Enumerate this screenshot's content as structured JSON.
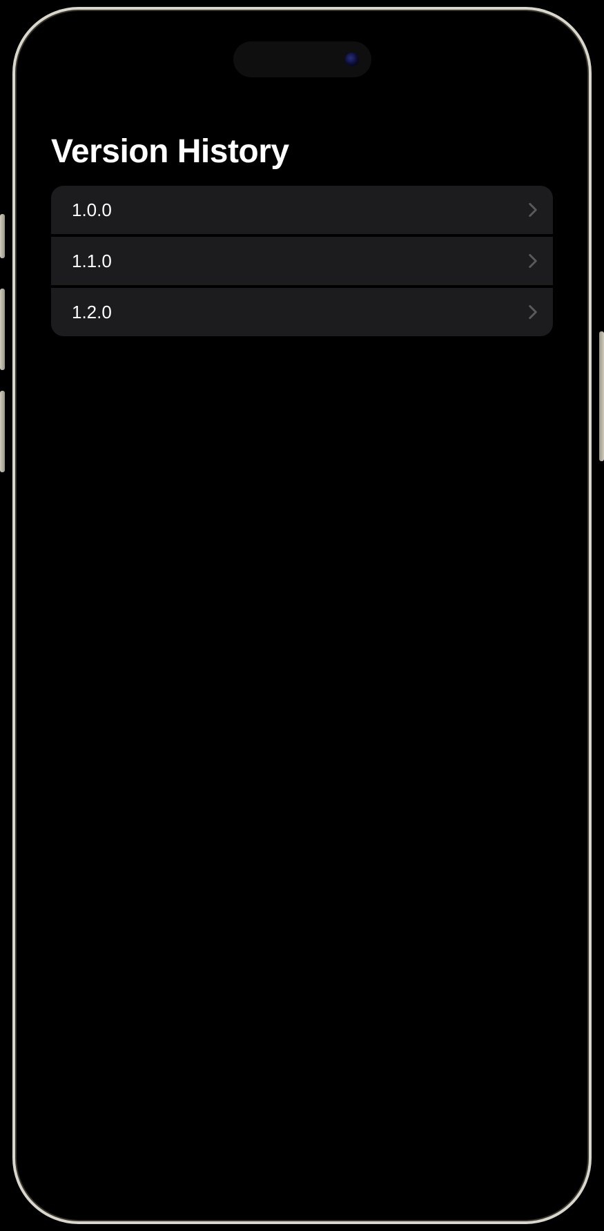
{
  "page": {
    "title": "Version History"
  },
  "versions": [
    {
      "label": "1.0.0"
    },
    {
      "label": "1.1.0"
    },
    {
      "label": "1.2.0"
    }
  ]
}
